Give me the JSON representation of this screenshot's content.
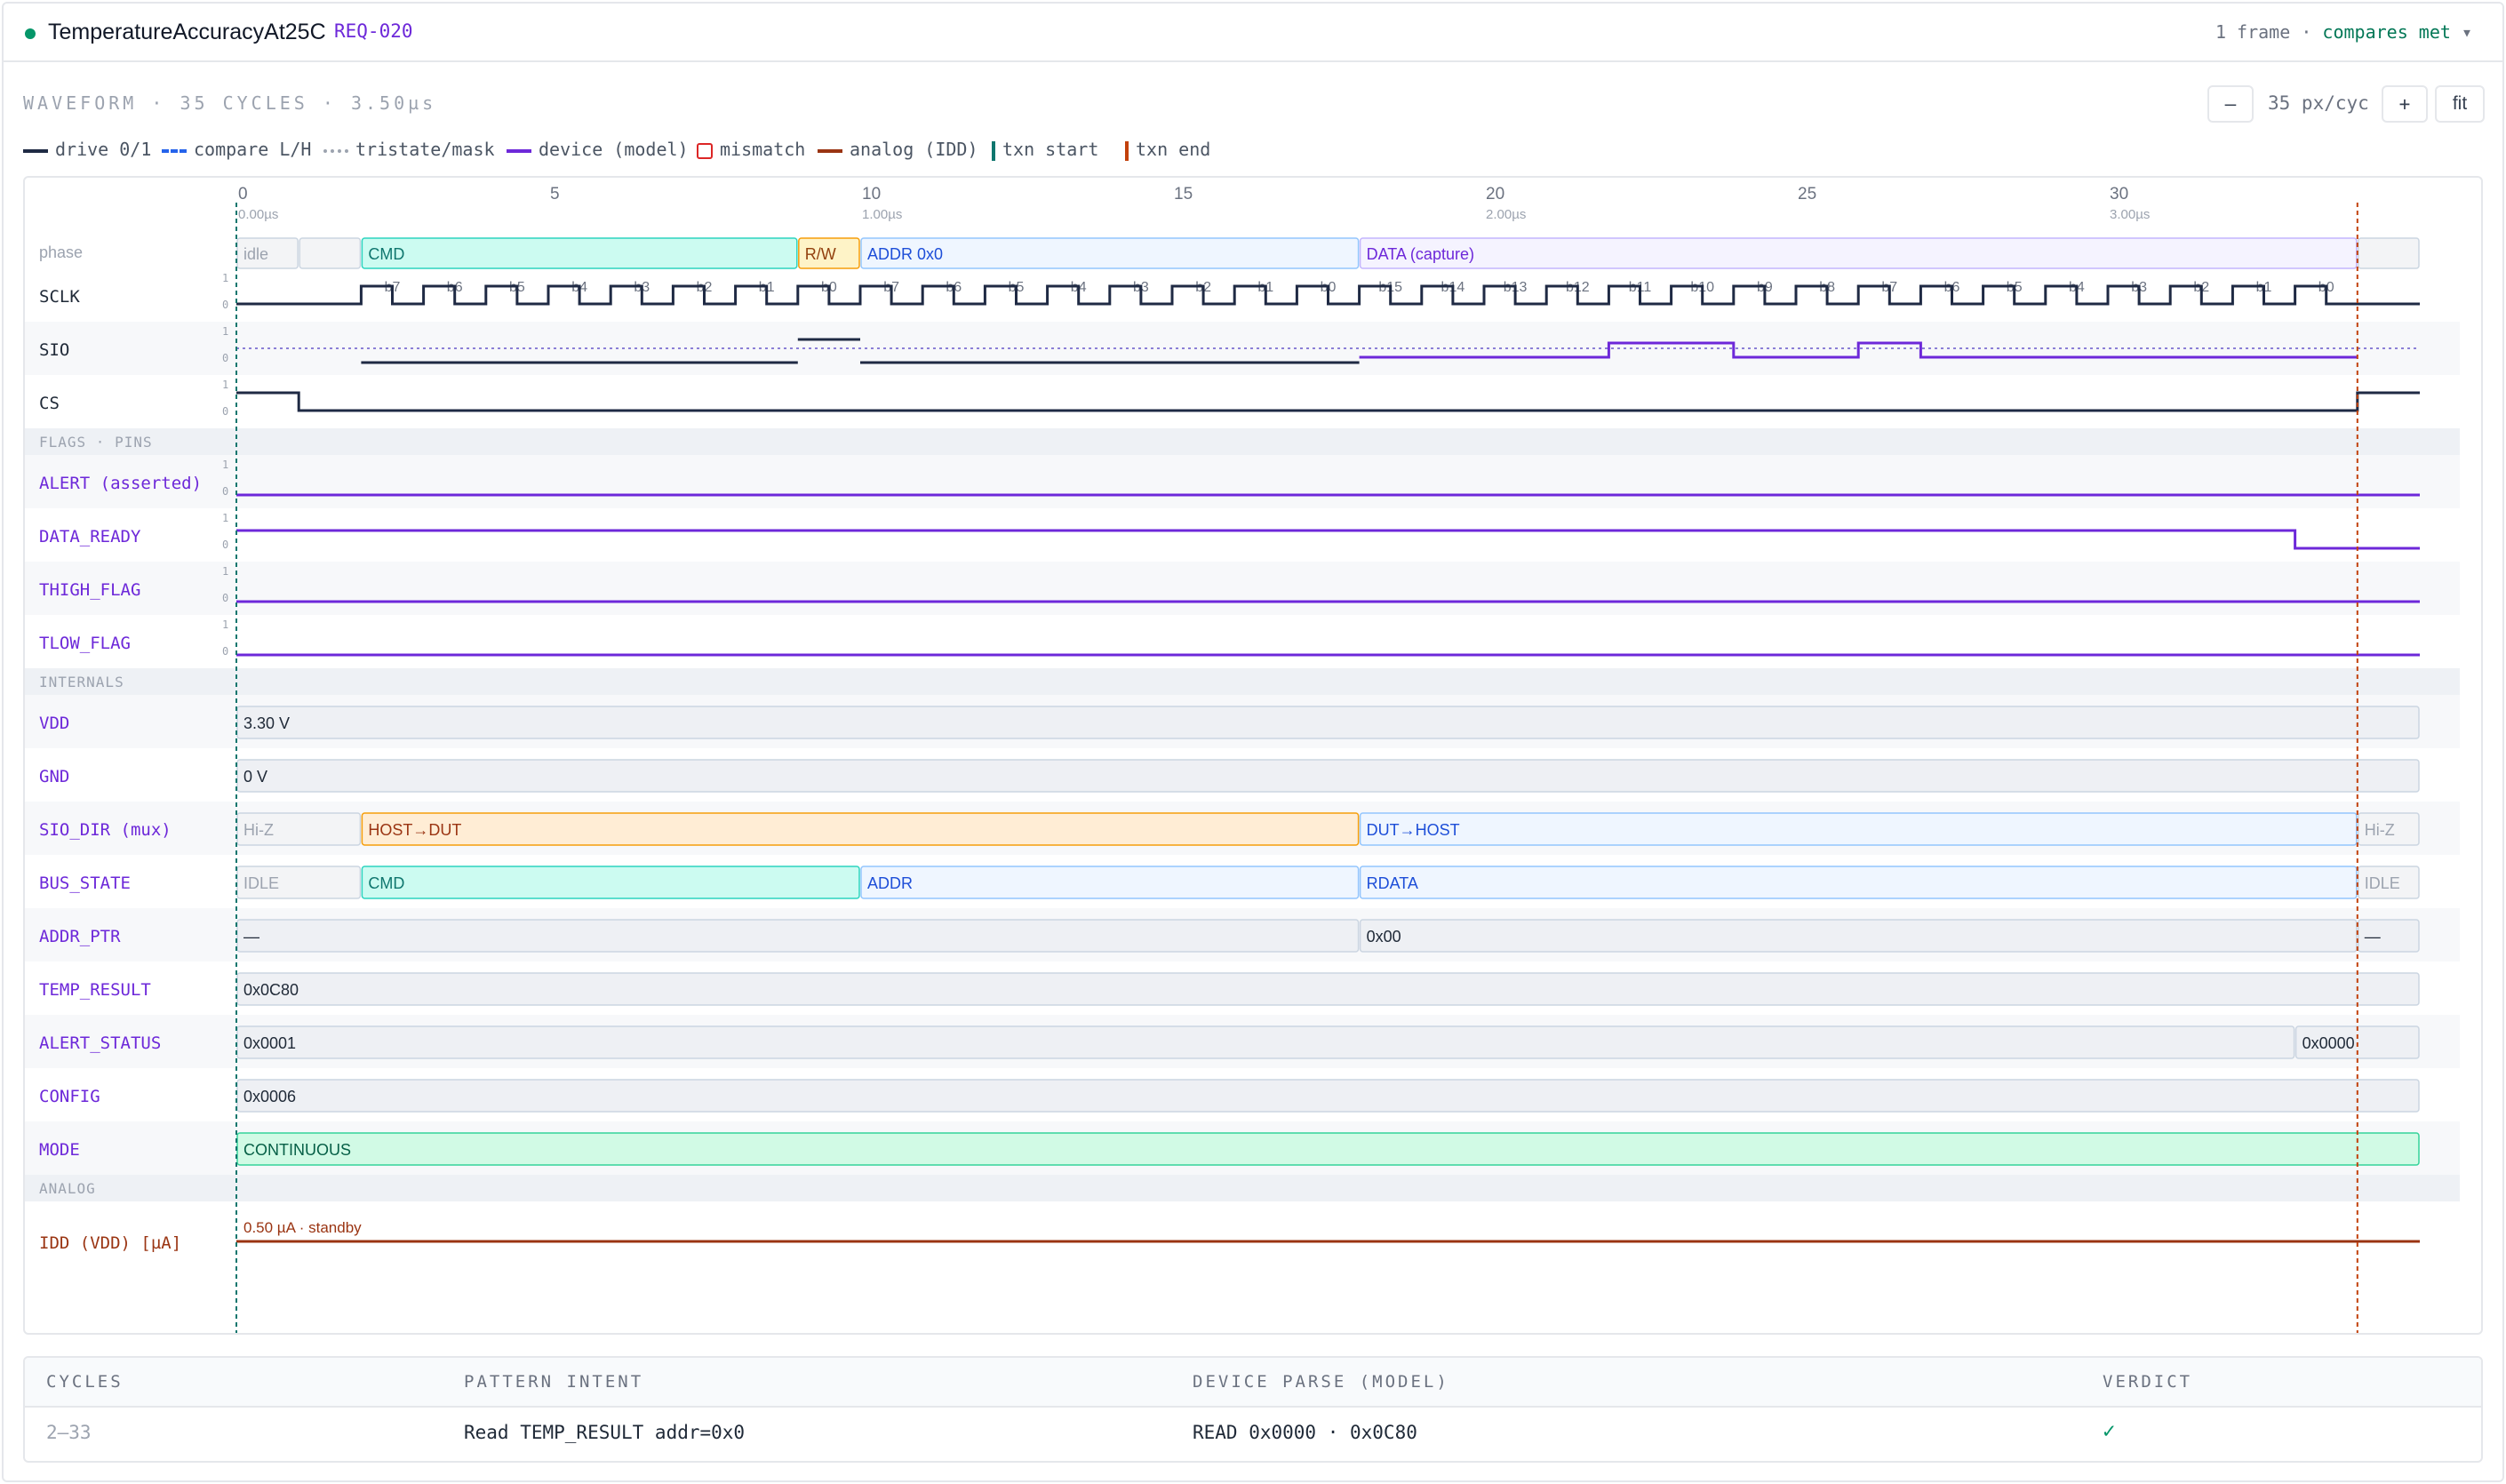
{
  "header": {
    "title": "TemperatureAccuracyAt25C",
    "req": "REQ-020",
    "frames": "1 frame",
    "sep": "·",
    "status": "compares met",
    "caret": "▾"
  },
  "waveform": {
    "label": "WAVEFORM · 35 CYCLES · 3.50µs",
    "zoom_out": "–",
    "zoom_text": "35 px/cyc",
    "zoom_in": "+",
    "fit": "fit"
  },
  "legend": [
    {
      "name": "drive",
      "label": "drive 0/1",
      "kind": "solid",
      "color": "#1f2a44"
    },
    {
      "name": "compare",
      "label": "compare L/H",
      "kind": "dashed",
      "color": "#2563eb"
    },
    {
      "name": "tristate",
      "label": "tristate/mask",
      "kind": "dotted",
      "color": "#9ca3af"
    },
    {
      "name": "device",
      "label": "device (model)",
      "kind": "solid",
      "color": "#6d28d9"
    },
    {
      "name": "mismatch",
      "label": "mismatch",
      "kind": "box",
      "color": "#dc2626"
    },
    {
      "name": "analog",
      "label": "analog (IDD)",
      "kind": "solid",
      "color": "#9a3412"
    },
    {
      "name": "txn-start",
      "label": "txn start",
      "kind": "bar",
      "color": "#0f766e"
    },
    {
      "name": "txn-end",
      "label": "txn end",
      "kind": "bar",
      "color": "#c2410c"
    }
  ],
  "timeline": {
    "cycles": 35,
    "ticks": [
      {
        "cycle": 0,
        "label": "0",
        "time": "0.00µs"
      },
      {
        "cycle": 5,
        "label": "5",
        "time": ""
      },
      {
        "cycle": 10,
        "label": "10",
        "time": "1.00µs"
      },
      {
        "cycle": 15,
        "label": "15",
        "time": ""
      },
      {
        "cycle": 20,
        "label": "20",
        "time": "2.00µs"
      },
      {
        "cycle": 25,
        "label": "25",
        "time": ""
      },
      {
        "cycle": 30,
        "label": "30",
        "time": "3.00µs"
      }
    ],
    "txn_start": 0,
    "txn_end": 34,
    "phase_label": "phase",
    "phases": [
      {
        "start": 0,
        "end": 1,
        "label": "idle",
        "kind": "idle"
      },
      {
        "start": 1,
        "end": 2,
        "label": "",
        "kind": "idle"
      },
      {
        "start": 2,
        "end": 9,
        "label": "CMD",
        "kind": "cmd"
      },
      {
        "start": 9,
        "end": 10,
        "label": "R/W",
        "kind": "rw"
      },
      {
        "start": 10,
        "end": 18,
        "label": "ADDR 0x0",
        "kind": "addr"
      },
      {
        "start": 18,
        "end": 34,
        "label": "DATA (capture)",
        "kind": "data"
      },
      {
        "start": 34,
        "end": 35,
        "label": "",
        "kind": "idle"
      }
    ],
    "bit_labels": [
      {
        "cycle": 2,
        "label": "b7"
      },
      {
        "cycle": 3,
        "label": "b6"
      },
      {
        "cycle": 4,
        "label": "b5"
      },
      {
        "cycle": 5,
        "label": "b4"
      },
      {
        "cycle": 6,
        "label": "b3"
      },
      {
        "cycle": 7,
        "label": "b2"
      },
      {
        "cycle": 8,
        "label": "b1"
      },
      {
        "cycle": 9,
        "label": "b0"
      },
      {
        "cycle": 10,
        "label": "b7"
      },
      {
        "cycle": 11,
        "label": "b6"
      },
      {
        "cycle": 12,
        "label": "b5"
      },
      {
        "cycle": 13,
        "label": "b4"
      },
      {
        "cycle": 14,
        "label": "b3"
      },
      {
        "cycle": 15,
        "label": "b2"
      },
      {
        "cycle": 16,
        "label": "b1"
      },
      {
        "cycle": 17,
        "label": "b0"
      },
      {
        "cycle": 18,
        "label": "b15"
      },
      {
        "cycle": 19,
        "label": "b14"
      },
      {
        "cycle": 20,
        "label": "b13"
      },
      {
        "cycle": 21,
        "label": "b12"
      },
      {
        "cycle": 22,
        "label": "b11"
      },
      {
        "cycle": 23,
        "label": "b10"
      },
      {
        "cycle": 24,
        "label": "b9"
      },
      {
        "cycle": 25,
        "label": "b8"
      },
      {
        "cycle": 26,
        "label": "b7"
      },
      {
        "cycle": 27,
        "label": "b6"
      },
      {
        "cycle": 28,
        "label": "b5"
      },
      {
        "cycle": 29,
        "label": "b4"
      },
      {
        "cycle": 30,
        "label": "b3"
      },
      {
        "cycle": 31,
        "label": "b2"
      },
      {
        "cycle": 32,
        "label": "b1"
      },
      {
        "cycle": 33,
        "label": "b0"
      }
    ]
  },
  "level_labels": {
    "high": "1",
    "low": "0"
  },
  "rows": [
    {
      "name": "SCLK",
      "kind": "clock",
      "label_color": "#1f2937",
      "shade": false,
      "low_until": 2,
      "pulses_until": 34
    },
    {
      "name": "SIO",
      "kind": "sio",
      "label_color": "#1f2937",
      "shade": true,
      "drive": [
        {
          "start": 2,
          "end": 9,
          "level": 0
        },
        {
          "start": 9,
          "end": 10,
          "level": 1
        },
        {
          "start": 10,
          "end": 18,
          "level": 0
        }
      ],
      "device": [
        {
          "start": 18,
          "end": 22,
          "level": 0
        },
        {
          "start": 22,
          "end": 24,
          "level": 1
        },
        {
          "start": 24,
          "end": 26,
          "level": 0
        },
        {
          "start": 26,
          "end": 27,
          "level": 1
        },
        {
          "start": 27,
          "end": 34,
          "level": 0
        }
      ]
    },
    {
      "name": "CS",
      "kind": "digital",
      "label_color": "#1f2937",
      "shade": false,
      "segments": [
        {
          "start": 0,
          "end": 1,
          "level": 1
        },
        {
          "start": 1,
          "end": 34,
          "level": 0
        },
        {
          "start": 34,
          "end": 35,
          "level": 1
        }
      ]
    },
    {
      "name": "FLAGS · PINS",
      "kind": "section"
    },
    {
      "name": "ALERT (asserted)",
      "kind": "flag",
      "label_color": "#6d28d9",
      "shade": true,
      "segments": [
        {
          "start": 0,
          "end": 35,
          "level": 0
        }
      ]
    },
    {
      "name": "DATA_READY",
      "kind": "flag",
      "label_color": "#6d28d9",
      "shade": false,
      "segments": [
        {
          "start": 0,
          "end": 33,
          "level": 1
        },
        {
          "start": 33,
          "end": 35,
          "level": 0
        }
      ]
    },
    {
      "name": "THIGH_FLAG",
      "kind": "flag",
      "label_color": "#6d28d9",
      "shade": true,
      "segments": [
        {
          "start": 0,
          "end": 35,
          "level": 0
        }
      ]
    },
    {
      "name": "TLOW_FLAG",
      "kind": "flag",
      "label_color": "#6d28d9",
      "shade": false,
      "segments": [
        {
          "start": 0,
          "end": 35,
          "level": 0
        }
      ]
    },
    {
      "name": "INTERNALS",
      "kind": "section"
    },
    {
      "name": "VDD",
      "kind": "bus",
      "label_color": "#6d28d9",
      "shade": true,
      "segments": [
        {
          "start": 0,
          "end": 35,
          "label": "3.30 V",
          "kind": "gray"
        }
      ]
    },
    {
      "name": "GND",
      "kind": "bus",
      "label_color": "#6d28d9",
      "shade": false,
      "segments": [
        {
          "start": 0,
          "end": 35,
          "label": "0 V",
          "kind": "gray"
        }
      ]
    },
    {
      "name": "SIO_DIR (mux)",
      "kind": "bus",
      "label_color": "#6d28d9",
      "shade": true,
      "segments": [
        {
          "start": 0,
          "end": 2,
          "label": "Hi-Z",
          "kind": "idle"
        },
        {
          "start": 2,
          "end": 18,
          "label": "HOST→DUT",
          "kind": "host"
        },
        {
          "start": 18,
          "end": 34,
          "label": "DUT→HOST",
          "kind": "dut"
        },
        {
          "start": 34,
          "end": 35,
          "label": "Hi-Z",
          "kind": "idle"
        }
      ]
    },
    {
      "name": "BUS_STATE",
      "kind": "bus",
      "label_color": "#6d28d9",
      "shade": false,
      "segments": [
        {
          "start": 0,
          "end": 2,
          "label": "IDLE",
          "kind": "idle"
        },
        {
          "start": 2,
          "end": 10,
          "label": "CMD",
          "kind": "cmd"
        },
        {
          "start": 10,
          "end": 18,
          "label": "ADDR",
          "kind": "addr"
        },
        {
          "start": 18,
          "end": 34,
          "label": "RDATA",
          "kind": "addr"
        },
        {
          "start": 34,
          "end": 35,
          "label": "IDLE",
          "kind": "idle"
        }
      ]
    },
    {
      "name": "ADDR_PTR",
      "kind": "bus",
      "label_color": "#6d28d9",
      "shade": true,
      "segments": [
        {
          "start": 0,
          "end": 18,
          "label": "—",
          "kind": "gray"
        },
        {
          "start": 18,
          "end": 34,
          "label": "0x00",
          "kind": "gray"
        },
        {
          "start": 34,
          "end": 35,
          "label": "—",
          "kind": "gray"
        }
      ]
    },
    {
      "name": "TEMP_RESULT",
      "kind": "bus",
      "label_color": "#6d28d9",
      "shade": false,
      "segments": [
        {
          "start": 0,
          "end": 35,
          "label": "0x0C80",
          "kind": "gray"
        }
      ]
    },
    {
      "name": "ALERT_STATUS",
      "kind": "bus",
      "label_color": "#6d28d9",
      "shade": true,
      "segments": [
        {
          "start": 0,
          "end": 33,
          "label": "0x0001",
          "kind": "gray"
        },
        {
          "start": 33,
          "end": 35,
          "label": "0x0000",
          "kind": "gray"
        }
      ]
    },
    {
      "name": "CONFIG",
      "kind": "bus",
      "label_color": "#6d28d9",
      "shade": false,
      "segments": [
        {
          "start": 0,
          "end": 35,
          "label": "0x0006",
          "kind": "gray"
        }
      ]
    },
    {
      "name": "MODE",
      "kind": "bus",
      "label_color": "#6d28d9",
      "shade": true,
      "segments": [
        {
          "start": 0,
          "end": 35,
          "label": "CONTINUOUS",
          "kind": "green"
        }
      ]
    },
    {
      "name": "ANALOG",
      "kind": "section"
    },
    {
      "name": "IDD (VDD) [µA]",
      "kind": "analog",
      "label_color": "#9a3412",
      "shade": false,
      "annotation": "0.50 µA · standby"
    }
  ],
  "colors": {
    "drive": "#1f2a44",
    "device": "#6d28d9",
    "analog": "#9a3412",
    "tristate": "#8b7fd6",
    "txn_start": "#0f766e",
    "txn_end": "#c2410c",
    "seg_idle": {
      "fill": "#f3f4f6",
      "stroke": "#cbd5e1",
      "text": "#9ca3af"
    },
    "seg_gray": {
      "fill": "#eef0f4",
      "stroke": "#cbd5e1",
      "text": "#1f2937"
    },
    "seg_cmd": {
      "fill": "#ccfbf1",
      "stroke": "#2dd4bf",
      "text": "#0f766e"
    },
    "seg_rw": {
      "fill": "#fef3c7",
      "stroke": "#f59e0b",
      "text": "#92400e"
    },
    "seg_addr": {
      "fill": "#eff6ff",
      "stroke": "#93c5fd",
      "text": "#1d4ed8"
    },
    "seg_dut": {
      "fill": "#eff6ff",
      "stroke": "#93c5fd",
      "text": "#1d4ed8"
    },
    "seg_data": {
      "fill": "#f5f3ff",
      "stroke": "#c4b5fd",
      "text": "#6d28d9"
    },
    "seg_host": {
      "fill": "#ffedd5",
      "stroke": "#f59e0b",
      "text": "#9a3412"
    },
    "seg_green": {
      "fill": "#d1fae5",
      "stroke": "#34d399",
      "text": "#065f46"
    }
  },
  "table": {
    "headers": [
      "CYCLES",
      "PATTERN INTENT",
      "DEVICE PARSE (MODEL)",
      "VERDICT"
    ],
    "rows": [
      {
        "cycles": "2–33",
        "intent": "Read TEMP_RESULT addr=0x0",
        "parse": "READ 0x0000 · 0x0C80",
        "verdict": "✓"
      }
    ]
  }
}
